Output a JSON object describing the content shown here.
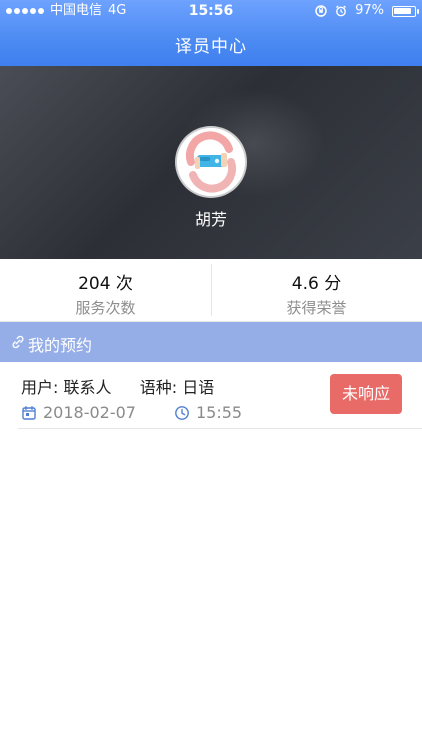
{
  "status_bar": {
    "carrier": "中国电信",
    "network": "4G",
    "time": "15:56",
    "battery": "97%",
    "battery_level": 0.97
  },
  "header": {
    "title": "译员中心"
  },
  "profile": {
    "name": "胡芳"
  },
  "stats": [
    {
      "value": "204 次",
      "label": "服务次数"
    },
    {
      "value": "4.6 分",
      "label": "获得荣誉"
    }
  ],
  "section": {
    "title": "我的预约"
  },
  "appointments": [
    {
      "user_label": "用户:",
      "user_value": "联系人",
      "lang_label": "语种:",
      "lang_value": "日语",
      "date": "2018-02-07",
      "time": "15:55",
      "status": "未响应"
    }
  ],
  "colors": {
    "header_blue": "#4c8bf2",
    "section_blue": "#95aee8",
    "status_red": "#e86b67",
    "icon_blue": "#4f7fd3"
  }
}
